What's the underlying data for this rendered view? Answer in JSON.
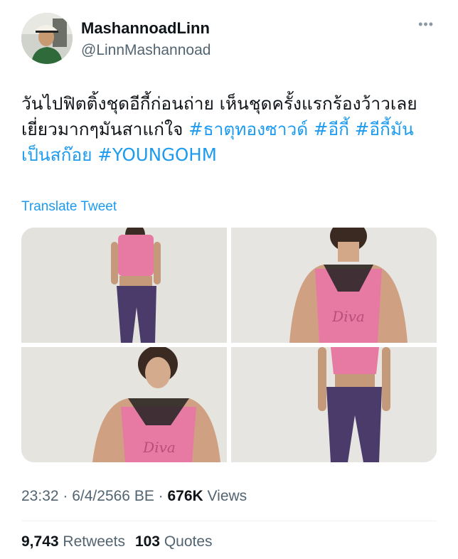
{
  "user": {
    "display_name": "MashannoadLinn",
    "handle": "@LinnMashannoad"
  },
  "more_icon": "more-horizontal-icon",
  "tweet": {
    "text": "วันไปฟิตติ้งชุดอีกี้ก่อนถ่าย เห็นชุดครั้งแรกร้องว้าวเลย เยี่ยวมากๆมันสาแก่ใจ ",
    "hashtags": [
      "#ธาตุทองซาวด์",
      "#อีกี้",
      "#อีกี้มันเป็นสก๊อย",
      "#YOUNGOHM"
    ]
  },
  "translate_label": "Translate Tweet",
  "photos": [
    {
      "subject": "full-body pink top patterned pants"
    },
    {
      "subject": "close-up pink tank top Diva"
    },
    {
      "subject": "portrait pink tank top Diva"
    },
    {
      "subject": "full-body pink crop top patterned pants"
    }
  ],
  "meta": {
    "time": "23:32",
    "date": "6/4/2566 BE",
    "views_count": "676K",
    "views_label": "Views"
  },
  "stats": {
    "retweets_count": "9,743",
    "retweets_label": "Retweets",
    "quotes_count": "103",
    "quotes_label": "Quotes"
  },
  "colors": {
    "accent": "#1d9bf0",
    "text": "#0f1419",
    "secondary": "#536471",
    "top_pink": "#e77aa3"
  }
}
